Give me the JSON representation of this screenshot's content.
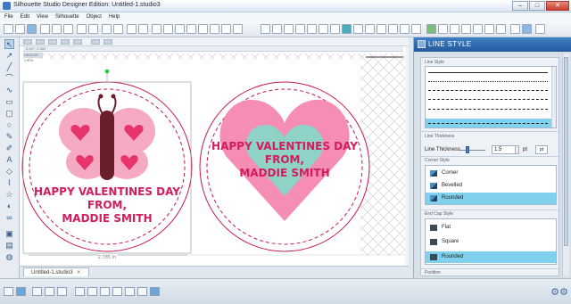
{
  "window": {
    "title": "Silhouette Studio Designer Edition: Untitled-1.studio3",
    "minimize": "–",
    "maximize": "□",
    "close": "✕"
  },
  "menu": [
    "File",
    "Edit",
    "View",
    "Silhouette",
    "Object",
    "Help"
  ],
  "canvas": {
    "ruler_label": "8.697, 2.586",
    "cut_label": "DESIGN VIEW",
    "dimension_label": "2.785 in",
    "design_text": {
      "line1": "HAPPY VALENTINES DAY",
      "line2": "FROM,",
      "line3": "MADDIE SMITH"
    }
  },
  "tabs": [
    {
      "label": "Untitled-1.studio3",
      "close": "✕"
    }
  ],
  "panel": {
    "title": "LINE STYLE",
    "line_style_label": "Line Style",
    "line_thickness_section": "Line Thickness",
    "line_thickness_label": "Line Thickness",
    "line_thickness_value": "1.5",
    "line_thickness_unit": "pt",
    "unit_button": "pt",
    "corner_style_label": "Corner Style",
    "corner_options": [
      {
        "label": "Corner",
        "selected": false
      },
      {
        "label": "Bevelled",
        "selected": false
      },
      {
        "label": "Rounded",
        "selected": true
      }
    ],
    "end_cap_label": "End Cap Style",
    "end_cap_options": [
      {
        "label": "Flat",
        "selected": false
      },
      {
        "label": "Square",
        "selected": false
      },
      {
        "label": "Rounded",
        "selected": true
      }
    ],
    "position_label": "Position"
  },
  "colors": {
    "accent": "#2a62a8",
    "selected": "#7fd1ee",
    "pink": "#f06a9f",
    "light_pink": "#f5a9c2",
    "heart_red": "#e7356c",
    "body_dark": "#6b1f2a",
    "mint": "#8fd3c8",
    "text_magenta": "#d11c5d"
  }
}
